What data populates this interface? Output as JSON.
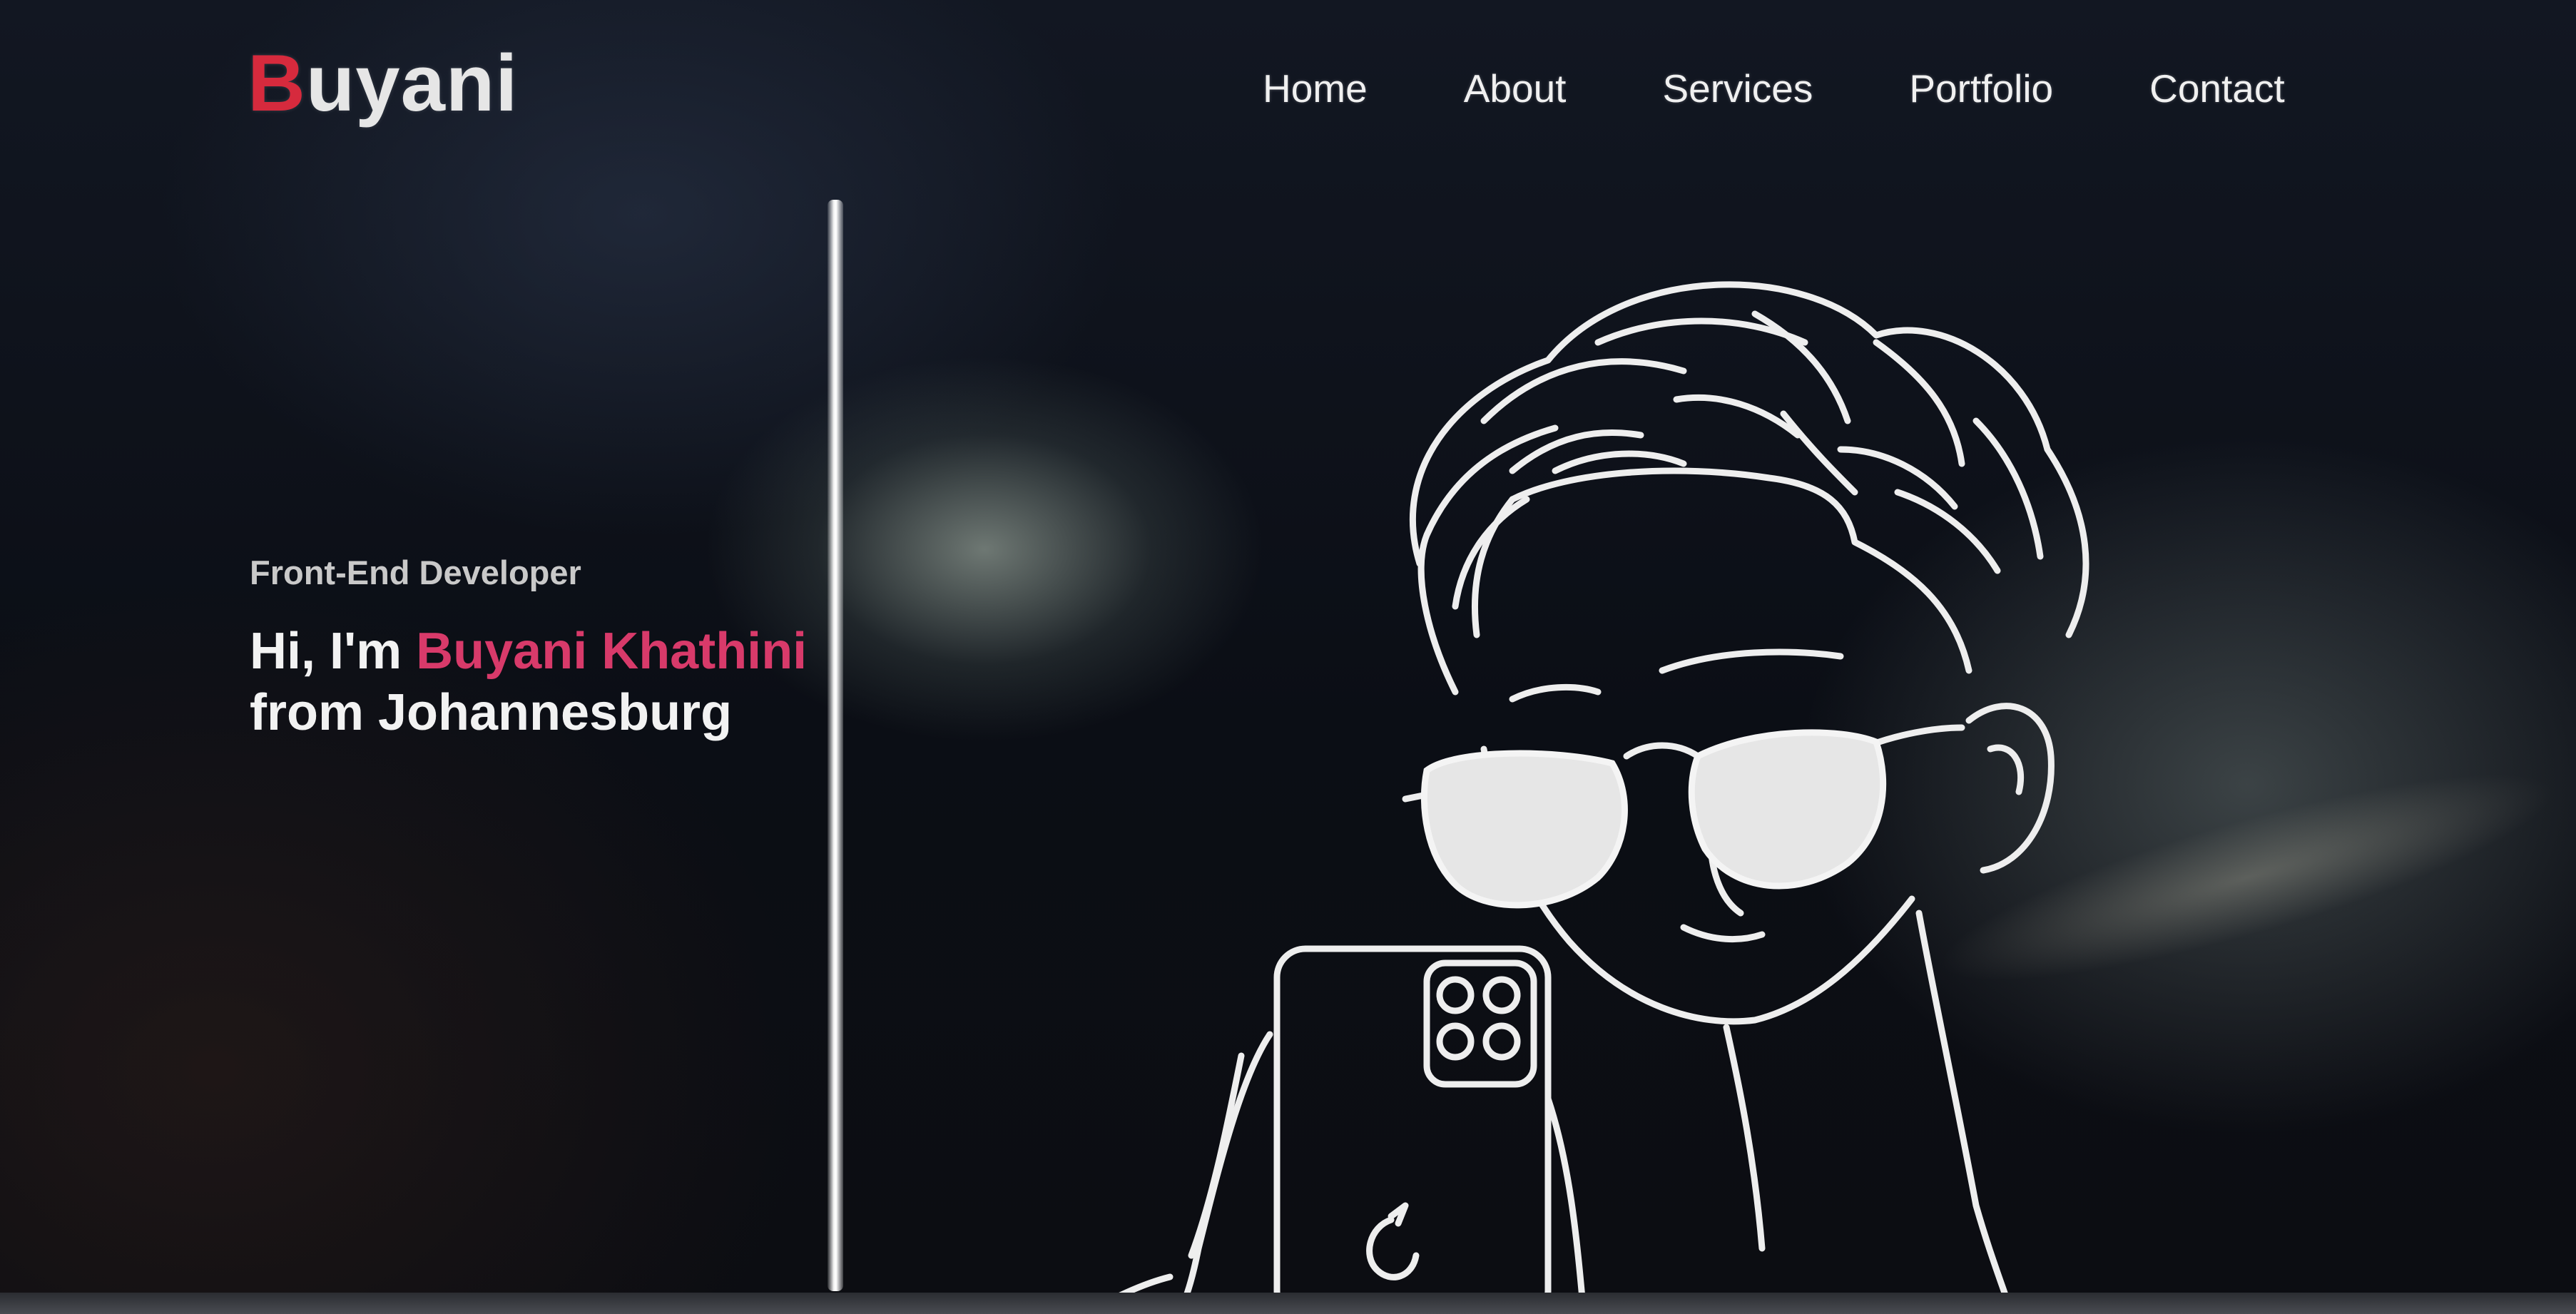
{
  "logo": {
    "first_letter": "B",
    "rest": "uyani"
  },
  "nav": {
    "items": [
      {
        "label": "Home"
      },
      {
        "label": "About"
      },
      {
        "label": "Services"
      },
      {
        "label": "Portfolio"
      },
      {
        "label": "Contact"
      }
    ]
  },
  "hero": {
    "role": "Front-End Developer",
    "greeting": "Hi, I'm ",
    "name": "Buyani Khathini",
    "location_line": "from Johannesburg"
  },
  "colors": {
    "accent_logo": "#d62a3d",
    "accent_name": "#d83a6a",
    "text": "#f2f2f2",
    "background": "#0b0e15"
  },
  "portrait": {
    "icon": "line-art-avatar-with-sunglasses-and-phone"
  }
}
